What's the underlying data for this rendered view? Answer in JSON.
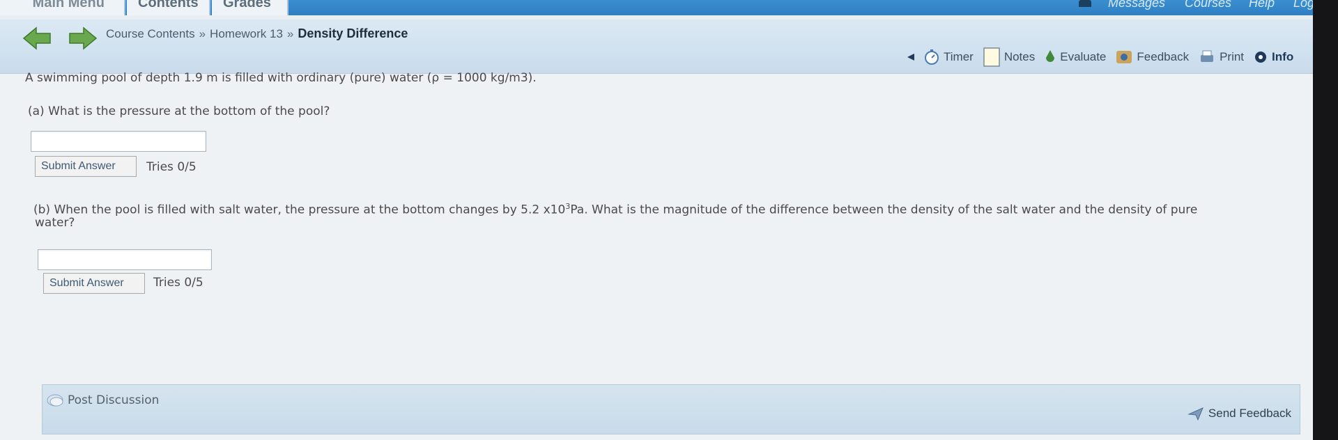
{
  "topnav": {
    "tabs": [
      "Main Menu",
      "Contents",
      "Grades"
    ],
    "right_links": [
      "Messages",
      "Courses",
      "Help",
      "Logout"
    ]
  },
  "breadcrumb": {
    "items": [
      "Course Contents",
      "Homework 13"
    ],
    "separator": "»",
    "current": "Density Difference"
  },
  "tools": {
    "timer": "Timer",
    "notes": "Notes",
    "evaluate": "Evaluate",
    "feedback": "Feedback",
    "print": "Print",
    "info": "Info"
  },
  "problem": {
    "intro": "A swimming pool of depth 1.9 m is filled with ordinary (pure) water (ρ = 1000 kg/m3).",
    "part_a": {
      "question": "(a) What is the pressure at the bottom of the pool?",
      "answer_value": "",
      "submit_label": "Submit Answer",
      "tries": "Tries 0/5"
    },
    "part_b": {
      "question_pre": "(b) When the pool is filled with salt water, the pressure at the bottom changes by 5.2 x10",
      "question_exp": "3",
      "question_post": "Pa. What is the magnitude of the difference between the density of the salt water and the density of pure",
      "question_line2": "water?",
      "answer_value": "",
      "submit_label": "Submit Answer",
      "tries": "Tries 0/5"
    }
  },
  "discussion": {
    "post_label": "Post Discussion",
    "send_feedback_label": "Send Feedback"
  },
  "colors": {
    "topbar": "#3a8fd0",
    "crumbbar": "#d3e4f1",
    "content_bg": "#eef2f5",
    "link": "#3d5a75"
  }
}
